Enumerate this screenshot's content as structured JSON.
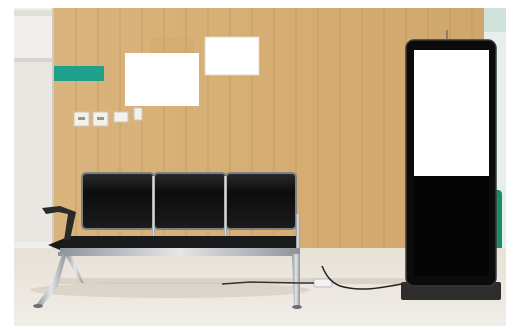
{
  "scene": {
    "description_visible_text": "",
    "colors": {
      "wall_wood": "#d8b077",
      "wall_wood_dark": "#c79f66",
      "wood_line": "#b88f58",
      "floor": "#e9e4da",
      "floor_shadow": "#d7d0c4",
      "left_wall": "#f1efec",
      "teal_sign": "#1fa08b",
      "seat_black": "#111111",
      "chrome": "#b8bcc0",
      "kiosk_frame": "#0b0b0b",
      "kiosk_screen": "#ffffff",
      "right_wall": "#e6efe9",
      "green_cylinder": "#1f8a6a"
    }
  }
}
